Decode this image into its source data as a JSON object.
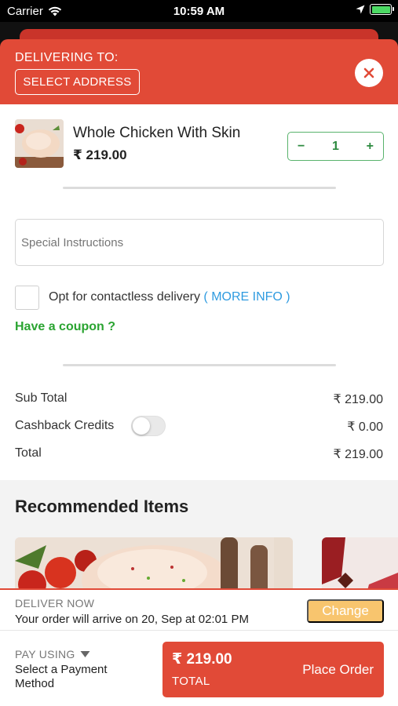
{
  "status_bar": {
    "carrier": "Carrier",
    "time": "10:59 AM"
  },
  "header": {
    "delivering_to_label": "DELIVERING TO:",
    "select_address_label": "SELECT ADDRESS"
  },
  "cart_item": {
    "name": "Whole Chicken With Skin",
    "price": "₹ 219.00",
    "quantity": "1",
    "minus": "−",
    "plus": "+"
  },
  "special_instructions": {
    "placeholder": "Special Instructions",
    "value": ""
  },
  "contactless": {
    "label": "Opt for contactless delivery",
    "more_info": "( MORE INFO )",
    "checked": false
  },
  "coupon_label": "Have a coupon ?",
  "summary": {
    "sub_total_label": "Sub Total",
    "sub_total_value": "₹ 219.00",
    "cashback_label": "Cashback Credits",
    "cashback_value": "₹ 0.00",
    "cashback_enabled": false,
    "total_label": "Total",
    "total_value": "₹ 219.00"
  },
  "recommended": {
    "title": "Recommended Items"
  },
  "delivery": {
    "mode": "DELIVER NOW",
    "arrival_text": "Your order will arrive on 20, Sep at 02:01 PM",
    "change_label": "Change"
  },
  "payment": {
    "pay_using_label": "PAY USING",
    "method_text": "Select a Payment Method"
  },
  "place_order": {
    "price": "₹ 219.00",
    "total_label": "TOTAL",
    "button_label": "Place Order"
  },
  "colors": {
    "primary": "#e14a37",
    "success_green": "#2aa431",
    "link_blue": "#2f9be0",
    "change_button": "#f8c56e"
  }
}
